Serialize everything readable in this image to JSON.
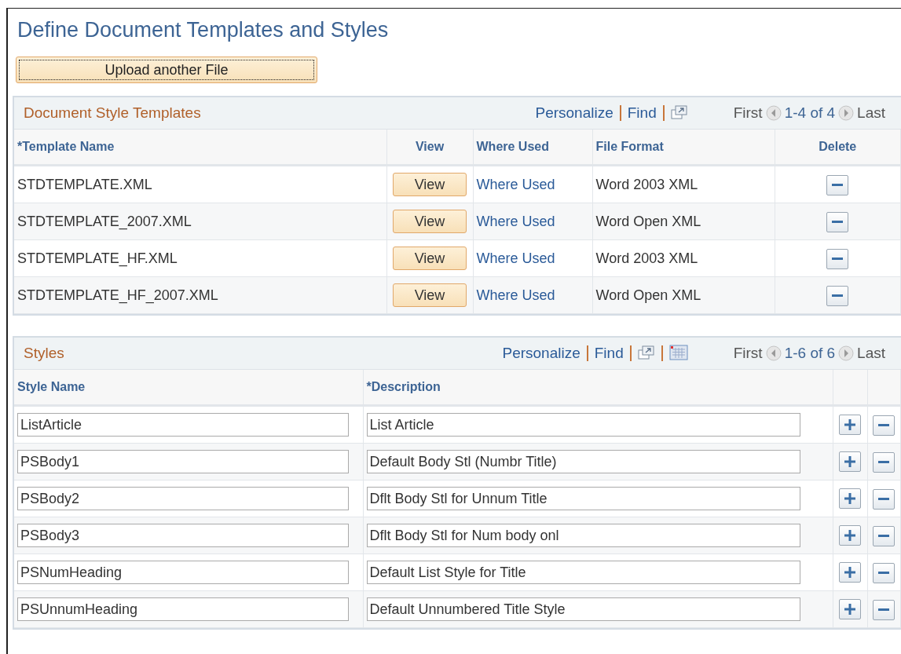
{
  "title": "Define Document Templates and Styles",
  "upload_button": "Upload another File",
  "templates": {
    "title": "Document Style Templates",
    "links": [
      "Personalize",
      "Find"
    ],
    "pager": {
      "first": "First",
      "range": "1-4 of 4",
      "last": "Last"
    },
    "columns": [
      "*Template Name",
      "View",
      "Where Used",
      "File Format",
      "Delete"
    ],
    "rows": [
      {
        "name": "STDTEMPLATE.XML",
        "view": "View",
        "where_used": "Where Used",
        "format": "Word 2003 XML"
      },
      {
        "name": "STDTEMPLATE_2007.XML",
        "view": "View",
        "where_used": "Where Used",
        "format": "Word Open XML"
      },
      {
        "name": "STDTEMPLATE_HF.XML",
        "view": "View",
        "where_used": "Where Used",
        "format": "Word 2003 XML"
      },
      {
        "name": "STDTEMPLATE_HF_2007.XML",
        "view": "View",
        "where_used": "Where Used",
        "format": "Word Open XML"
      }
    ]
  },
  "styles": {
    "title": "Styles",
    "links": [
      "Personalize",
      "Find"
    ],
    "pager": {
      "first": "First",
      "range": "1-6 of 6",
      "last": "Last"
    },
    "columns": [
      "Style Name",
      "*Description"
    ],
    "rows": [
      {
        "name": "ListArticle",
        "description": "List Article"
      },
      {
        "name": "PSBody1",
        "description": "Default Body Stl (Numbr Title)"
      },
      {
        "name": "PSBody2",
        "description": "Dflt Body Stl for Unnum Title"
      },
      {
        "name": "PSBody3",
        "description": "Dflt Body Stl for Num body onl"
      },
      {
        "name": "PSNumHeading",
        "description": "Default List Style for Title"
      },
      {
        "name": "PSUnnumHeading",
        "description": "Default Unnumbered Title Style"
      }
    ]
  }
}
